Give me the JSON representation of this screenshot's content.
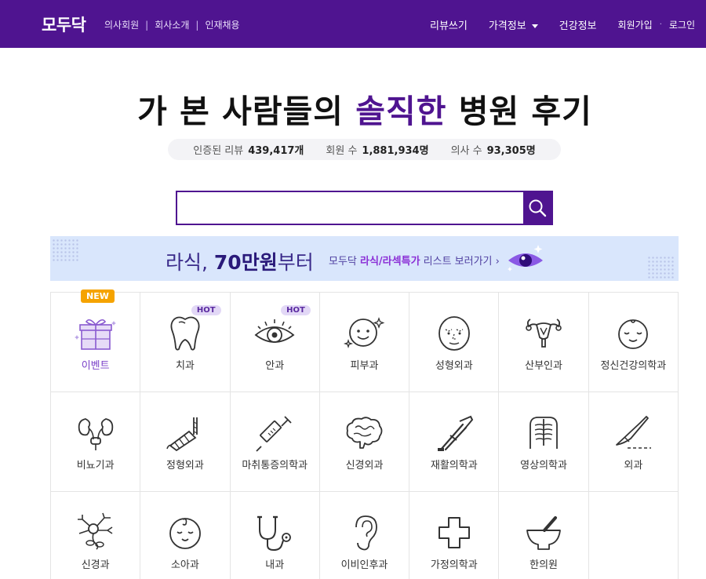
{
  "nav": {
    "logo": "모두닥",
    "sub_links": [
      "의사회원",
      "회사소개",
      "인재채용"
    ],
    "sub_separator": "|",
    "right_links": [
      "리뷰쓰기",
      "가격정보",
      "건강정보"
    ],
    "signup": "회원가입",
    "login": "로그인",
    "dot": "·"
  },
  "hero": {
    "headline_pre": "가 본 사람들의 ",
    "headline_accent": "솔직한",
    "headline_post": " 병원 후기",
    "stats": {
      "reviews_label": "인증된 리뷰",
      "reviews_value": "439,417개",
      "members_label": "회원 수",
      "members_value": "1,881,934명",
      "doctors_label": "의사 수",
      "doctors_value": "93,305명"
    }
  },
  "search": {
    "placeholder": ""
  },
  "banner": {
    "big_pre": "라식, ",
    "big_bold": "70만원",
    "big_post": "부터",
    "small_pre": "모두닥 ",
    "small_hl": "라식/라섹특가",
    "small_post": " 리스트 보러가기 ›"
  },
  "badges": {
    "new": "NEW",
    "hot": "HOT"
  },
  "categories": [
    {
      "label": "이벤트",
      "icon": "gift-icon"
    },
    {
      "label": "치과",
      "icon": "tooth-icon"
    },
    {
      "label": "안과",
      "icon": "eye-icon"
    },
    {
      "label": "피부과",
      "icon": "face-sparkle-icon"
    },
    {
      "label": "성형외과",
      "icon": "face-dotted-icon"
    },
    {
      "label": "산부인과",
      "icon": "uterus-icon"
    },
    {
      "label": "정신건강의학과",
      "icon": "calm-face-icon"
    },
    {
      "label": "비뇨기과",
      "icon": "kidney-icon"
    },
    {
      "label": "정형외과",
      "icon": "cast-arm-icon"
    },
    {
      "label": "마취통증의학과",
      "icon": "syringe-icon"
    },
    {
      "label": "신경외과",
      "icon": "brain-icon"
    },
    {
      "label": "재활의학과",
      "icon": "crutch-icon"
    },
    {
      "label": "영상의학과",
      "icon": "xray-icon"
    },
    {
      "label": "외과",
      "icon": "scalpel-icon"
    },
    {
      "label": "신경과",
      "icon": "neuron-icon"
    },
    {
      "label": "소아과",
      "icon": "baby-face-icon"
    },
    {
      "label": "내과",
      "icon": "stethoscope-icon"
    },
    {
      "label": "이비인후과",
      "icon": "ear-icon"
    },
    {
      "label": "가정의학과",
      "icon": "cross-icon"
    },
    {
      "label": "한의원",
      "icon": "mortar-icon"
    }
  ],
  "colors": {
    "brand": "#4f1490",
    "banner_bg": "#d9e6fc",
    "badge_new": "#f5a300",
    "badge_hot_bg": "#e2d8f6"
  }
}
